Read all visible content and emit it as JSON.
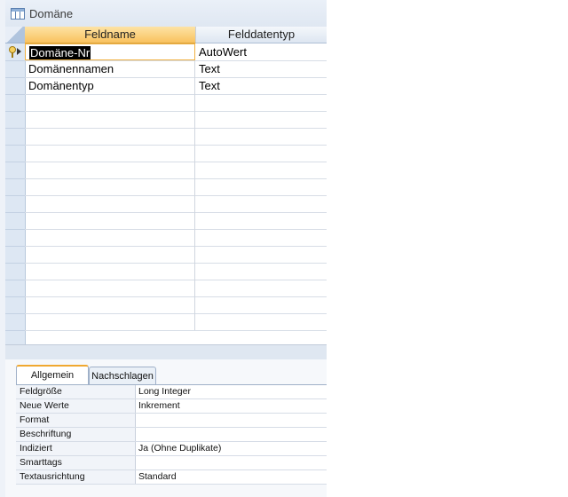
{
  "window": {
    "title": "Domäne"
  },
  "grid": {
    "headers": [
      "Feldname",
      "Felddatentyp"
    ],
    "rows": [
      {
        "name": "Domäne-Nr",
        "type": "AutoWert",
        "primary_key": true,
        "current": true
      },
      {
        "name": "Domänennamen",
        "type": "Text"
      },
      {
        "name": "Domänentyp",
        "type": "Text"
      }
    ],
    "empty_rows": 14
  },
  "properties": {
    "tabs": [
      {
        "label": "Allgemein",
        "active": true
      },
      {
        "label": "Nachschlagen",
        "active": false
      }
    ],
    "rows": [
      {
        "label": "Feldgröße",
        "value": "Long Integer"
      },
      {
        "label": "Neue Werte",
        "value": "Inkrement"
      },
      {
        "label": "Format",
        "value": ""
      },
      {
        "label": "Beschriftung",
        "value": ""
      },
      {
        "label": "Indiziert",
        "value": "Ja (Ohne Duplikate)"
      },
      {
        "label": "Smarttags",
        "value": ""
      },
      {
        "label": "Textausrichtung",
        "value": "Standard"
      }
    ]
  },
  "background_window": {
    "fragments": [
      "",
      "",
      "",
      "",
      "",
      "",
      "",
      "",
      ""
    ]
  },
  "colors": {
    "header_accent": "#f9c25e",
    "selection": "#000000",
    "active_tab_accent": "#f0a830"
  }
}
